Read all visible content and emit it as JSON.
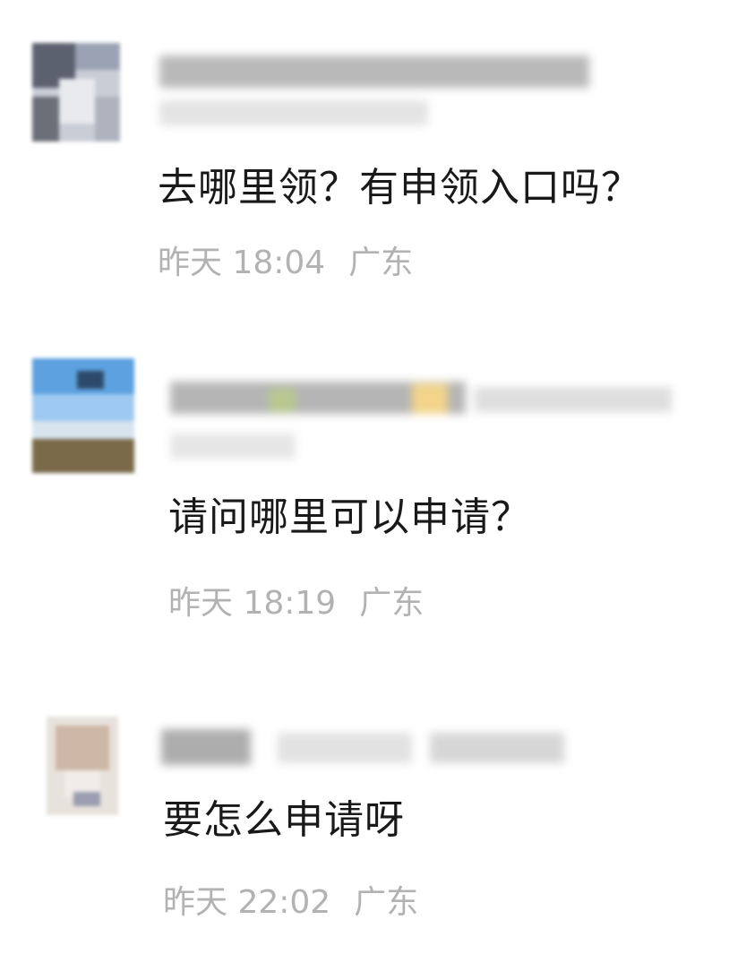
{
  "comments": [
    {
      "username": "",
      "text": "去哪里领？有申领入口吗？",
      "time": "昨天 18:04",
      "location": "广东"
    },
    {
      "username": "",
      "text": "请问哪里可以申请？",
      "time": "昨天 18:19",
      "location": "广东"
    },
    {
      "username": "",
      "text": "要怎么申请呀",
      "time": "昨天 22:02",
      "location": "广东"
    }
  ],
  "colors": {
    "text": "#191919",
    "meta": "#b2b2b2",
    "background": "#ffffff"
  }
}
